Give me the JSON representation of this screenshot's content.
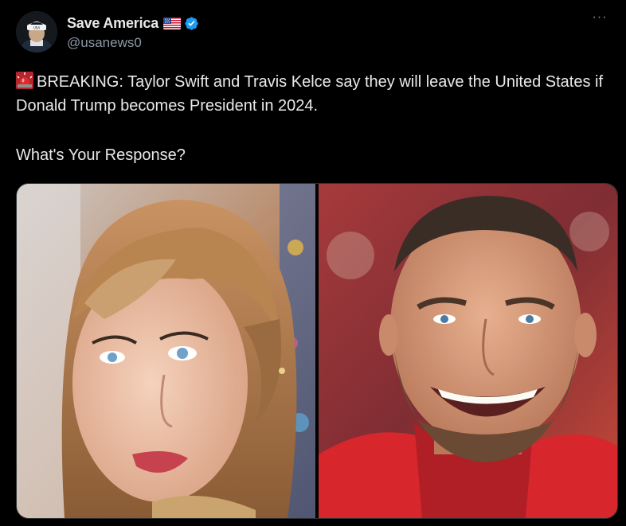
{
  "author": {
    "display_name": "Save America",
    "handle": "@usanews0",
    "flag_icon": "us-flag-emoji",
    "verified_icon": "verified-badge-icon",
    "avatar_icon": "avatar-image"
  },
  "more_icon_label": "···",
  "tweet": {
    "line1_icon": "siren-emoji",
    "line1": "BREAKING: Taylor Swift and Travis Kelce say they will leave the United States if Donald Trump becomes President in 2024.",
    "line2": "What's Your Response?"
  },
  "media": {
    "photo_count": 2,
    "photos": [
      {
        "icon": "photo-left-woman"
      },
      {
        "icon": "photo-right-man"
      }
    ]
  },
  "colors": {
    "background": "#000000",
    "text": "#e7e9ea",
    "secondary_text": "#8b98a5",
    "verified": "#1d9bf0",
    "border": "#2f3336"
  }
}
